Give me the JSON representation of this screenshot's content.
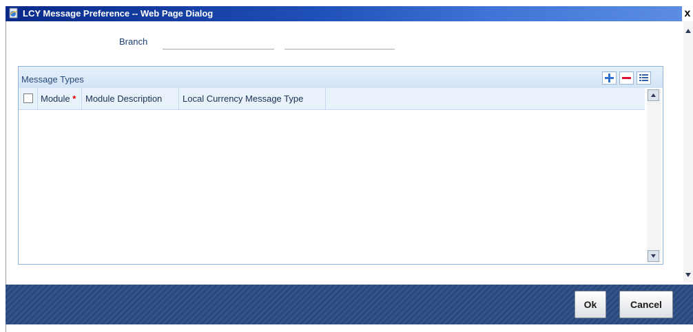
{
  "window": {
    "title": "LCY Message Preference -- Web Page Dialog",
    "close_glyph": "x",
    "icon": "ie-page-icon"
  },
  "form": {
    "branch_label": "Branch",
    "branch_code_value": "",
    "branch_name_value": ""
  },
  "grid": {
    "title": "Message Types",
    "toolbar": [
      "add-row-icon",
      "delete-row-icon",
      "single-view-icon"
    ],
    "columns": [
      {
        "label": "Module",
        "required_marker": "*"
      },
      {
        "label": "Module Description"
      },
      {
        "label": "Local Currency Message Type"
      }
    ],
    "rows": []
  },
  "footer": {
    "ok_label": "Ok",
    "cancel_label": "Cancel"
  },
  "colors": {
    "titlebar": "#0a2a8a",
    "grid_header": "#dce9f8",
    "footer": "#2c4a7c",
    "required": "#e00000"
  }
}
